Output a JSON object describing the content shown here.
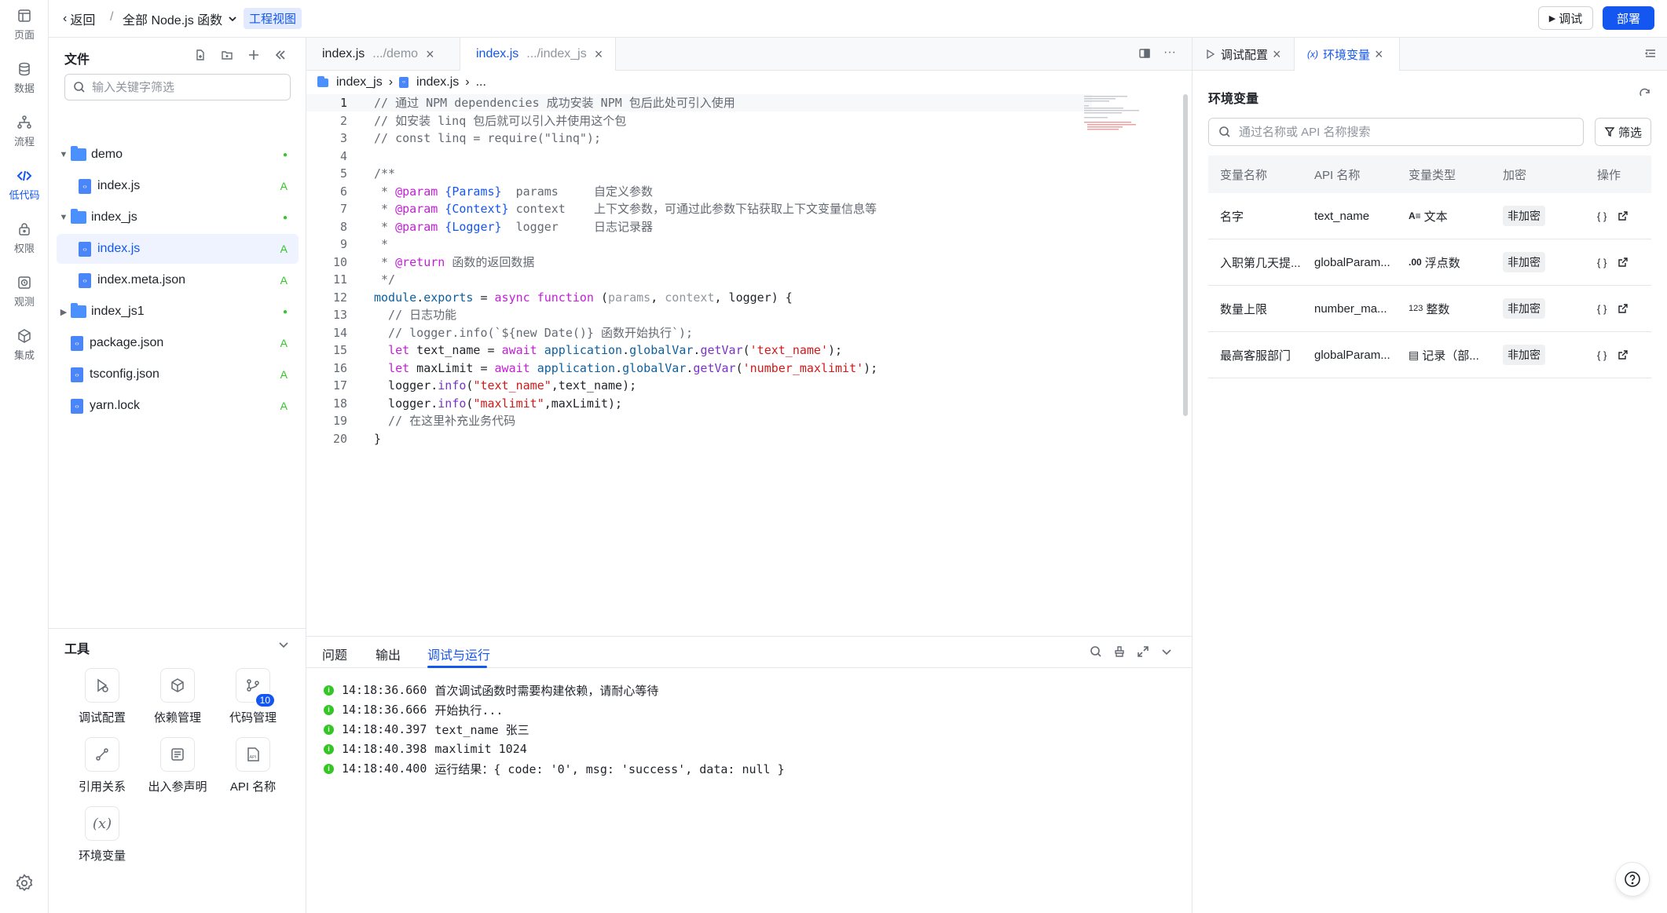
{
  "rail": {
    "items": [
      {
        "label": "页面",
        "icon": "page-icon"
      },
      {
        "label": "数据",
        "icon": "database-icon"
      },
      {
        "label": "流程",
        "icon": "flow-icon"
      },
      {
        "label": "低代码",
        "icon": "code-icon"
      },
      {
        "label": "权限",
        "icon": "lock-icon"
      },
      {
        "label": "观测",
        "icon": "observe-icon"
      },
      {
        "label": "集成",
        "icon": "cube-icon"
      }
    ],
    "active_index": 3
  },
  "topbar": {
    "back_label": "返回",
    "separator": "/",
    "function_scope": "全部 Node.js 函数",
    "view_tag": "工程视图",
    "debug_label": "调试",
    "deploy_label": "部署"
  },
  "files": {
    "title": "文件",
    "search_placeholder": "输入关键字筛选",
    "tree": [
      {
        "name": "demo",
        "type": "folder",
        "expanded": true,
        "status": "●"
      },
      {
        "name": "index.js",
        "type": "file",
        "status": "A"
      },
      {
        "name": "index_js",
        "type": "folder",
        "expanded": true,
        "status": "●"
      },
      {
        "name": "index.js",
        "type": "file",
        "status": "A",
        "selected": true
      },
      {
        "name": "index.meta.json",
        "type": "file",
        "status": "A"
      },
      {
        "name": "index_js1",
        "type": "folder",
        "expanded": false,
        "status": "●"
      },
      {
        "name": "package.json",
        "type": "file",
        "status": "A"
      },
      {
        "name": "tsconfig.json",
        "type": "file",
        "status": "A"
      },
      {
        "name": "yarn.lock",
        "type": "file",
        "status": "A"
      }
    ]
  },
  "tools": {
    "title": "工具",
    "items": [
      {
        "label": "调试配置",
        "icon": "debug-config-icon"
      },
      {
        "label": "依赖管理",
        "icon": "package-icon"
      },
      {
        "label": "代码管理",
        "icon": "git-icon",
        "badge": "10"
      },
      {
        "label": "引用关系",
        "icon": "reference-icon"
      },
      {
        "label": "出入参声明",
        "icon": "params-icon"
      },
      {
        "label": "API 名称",
        "icon": "api-icon"
      },
      {
        "label": "环境变量",
        "icon": "variable-icon"
      }
    ]
  },
  "editor": {
    "tabs": [
      {
        "name": "index.js",
        "path": ".../demo",
        "active": false
      },
      {
        "name": "index.js",
        "path": ".../index_js",
        "active": true
      }
    ],
    "breadcrumb": [
      "index_js",
      "index.js",
      "..."
    ],
    "current_line": 1,
    "lines": [
      "// 通过 NPM dependencies 成功安装 NPM 包后此处可引入使用",
      "// 如安装 linq 包后就可以引入并使用这个包",
      "// const linq = require(\"linq\");",
      "",
      "/**",
      " * @param {Params}  params     自定义参数",
      " * @param {Context} context    上下文参数，可通过此参数下钻获取上下文变量信息等",
      " * @param {Logger}  logger     日志记录器",
      " *",
      " * @return 函数的返回数据",
      " */",
      "module.exports = async function (params, context, logger) {",
      "  // 日志功能",
      "  // logger.info(`${new Date()} 函数开始执行`);",
      "  let text_name = await application.globalVar.getVar('text_name');",
      "  let maxLimit = await application.globalVar.getVar('number_maxlimit');",
      "  logger.info(\"text_name\",text_name);",
      "  logger.info(\"maxlimit\",maxLimit);",
      "  // 在这里补充业务代码",
      "}"
    ]
  },
  "bottom": {
    "tabs": [
      "问题",
      "输出",
      "调试与运行"
    ],
    "active_tab": 2,
    "logs": [
      {
        "time": "14:18:36.660",
        "text": "首次调试函数时需要构建依赖，请耐心等待"
      },
      {
        "time": "14:18:36.666",
        "text": "开始执行..."
      },
      {
        "time": "14:18:40.397",
        "text": "text_name 张三"
      },
      {
        "time": "14:18:40.398",
        "text": "maxlimit 1024"
      },
      {
        "time": "14:18:40.400",
        "text": "运行结果：{ code: '0', msg: 'success', data: null }"
      }
    ]
  },
  "right": {
    "tabs": [
      {
        "label": "调试配置",
        "active": false
      },
      {
        "label": "环境变量",
        "active": true
      }
    ],
    "title": "环境变量",
    "search_placeholder": "通过名称或 API 名称搜索",
    "filter_label": "筛选",
    "columns": [
      "变量名称",
      "API 名称",
      "变量类型",
      "加密",
      "操作"
    ],
    "rows": [
      {
        "name": "名字",
        "api": "text_name",
        "type_icon": "A≡",
        "type": "文本",
        "encrypt": "非加密"
      },
      {
        "name": "入职第几天提...",
        "api": "globalParam...",
        "type_icon": ".00",
        "type": "浮点数",
        "encrypt": "非加密"
      },
      {
        "name": "数量上限",
        "api": "number_ma...",
        "type_icon": "123",
        "type": "整数",
        "encrypt": "非加密"
      },
      {
        "name": "最高客服部门",
        "api": "globalParam...",
        "type_icon": "▤",
        "type": "记录（部...",
        "encrypt": "非加密"
      }
    ]
  },
  "colors": {
    "accent": "#1456f0",
    "success": "#34c724",
    "border": "#e5e6eb"
  }
}
